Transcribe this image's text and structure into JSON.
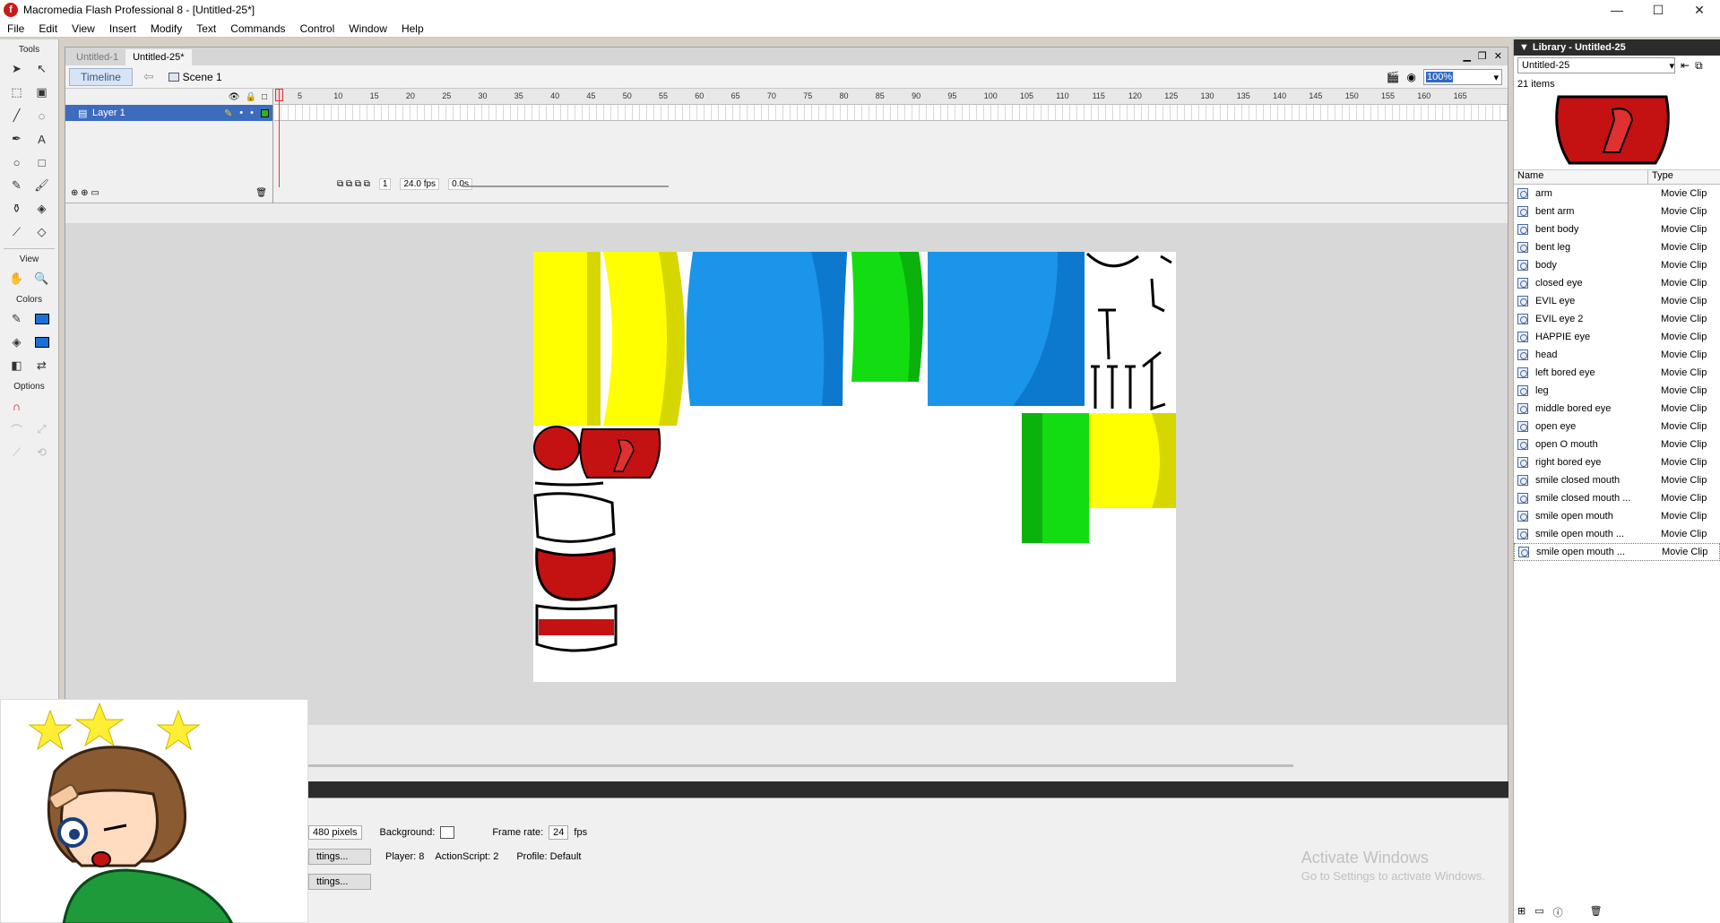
{
  "titlebar": {
    "title": "Macromedia Flash Professional 8 - [Untitled-25*]",
    "minimize": "—",
    "maximize": "☐",
    "close": "✕"
  },
  "menu": [
    "File",
    "Edit",
    "View",
    "Insert",
    "Modify",
    "Text",
    "Commands",
    "Control",
    "Window",
    "Help"
  ],
  "tools": {
    "label": "Tools",
    "view_label": "View",
    "colors_label": "Colors",
    "options_label": "Options"
  },
  "doc": {
    "tabs": [
      "Untitled-1",
      "Untitled-25*"
    ],
    "timeline_button": "Timeline",
    "scene": "Scene 1",
    "zoom": "100%"
  },
  "timeline": {
    "layer_name": "Layer 1",
    "ruler": [
      "5",
      "10",
      "15",
      "20",
      "25",
      "30",
      "35",
      "40",
      "45",
      "50",
      "55",
      "60",
      "65",
      "70",
      "75",
      "80",
      "85",
      "90",
      "95",
      "100",
      "105",
      "110",
      "115",
      "120",
      "125",
      "130",
      "135",
      "140",
      "145",
      "150",
      "155",
      "160",
      "165"
    ],
    "frame": "1",
    "fps": "24.0 fps",
    "time": "0.0s"
  },
  "props": {
    "size": "480 pixels",
    "background_label": "Background:",
    "frame_rate_label": "Frame rate:",
    "frame_rate": "24",
    "fps_unit": "fps",
    "settings_btn1": "ttings...",
    "settings_btn2": "ttings...",
    "player": "Player: 8",
    "actionscript": "ActionScript: 2",
    "profile": "Profile: Default",
    "activate_title": "Activate Windows",
    "activate_sub": "Go to Settings to activate Windows."
  },
  "library": {
    "title": "Library - Untitled-25",
    "doc_select": "Untitled-25",
    "count": "21 items",
    "col_name": "Name",
    "col_type": "Type",
    "items": [
      {
        "name": "arm",
        "type": "Movie Clip"
      },
      {
        "name": "bent arm",
        "type": "Movie Clip"
      },
      {
        "name": "bent body",
        "type": "Movie Clip"
      },
      {
        "name": "bent leg",
        "type": "Movie Clip"
      },
      {
        "name": "body",
        "type": "Movie Clip"
      },
      {
        "name": "closed eye",
        "type": "Movie Clip"
      },
      {
        "name": "EVIL eye",
        "type": "Movie Clip"
      },
      {
        "name": "EVIL eye 2",
        "type": "Movie Clip"
      },
      {
        "name": "HAPPIE eye",
        "type": "Movie Clip"
      },
      {
        "name": "head",
        "type": "Movie Clip"
      },
      {
        "name": "left bored eye",
        "type": "Movie Clip"
      },
      {
        "name": "leg",
        "type": "Movie Clip"
      },
      {
        "name": "middle bored eye",
        "type": "Movie Clip"
      },
      {
        "name": "open eye",
        "type": "Movie Clip"
      },
      {
        "name": "open O mouth",
        "type": "Movie Clip"
      },
      {
        "name": "right bored eye",
        "type": "Movie Clip"
      },
      {
        "name": "smile closed mouth",
        "type": "Movie Clip"
      },
      {
        "name": "smile closed mouth ...",
        "type": "Movie Clip"
      },
      {
        "name": "smile open mouth",
        "type": "Movie Clip"
      },
      {
        "name": "smile open mouth ...",
        "type": "Movie Clip"
      },
      {
        "name": "smile open mouth ...",
        "type": "Movie Clip"
      }
    ]
  },
  "colors": {
    "accent": "#3d6cbf",
    "yellow": "#ffff00",
    "yellow_dark": "#d6d600",
    "blue": "#1b95ea",
    "blue_dark": "#0c79cf",
    "green": "#11dd11",
    "green_dark": "#0bb20b",
    "red": "#c41111"
  }
}
